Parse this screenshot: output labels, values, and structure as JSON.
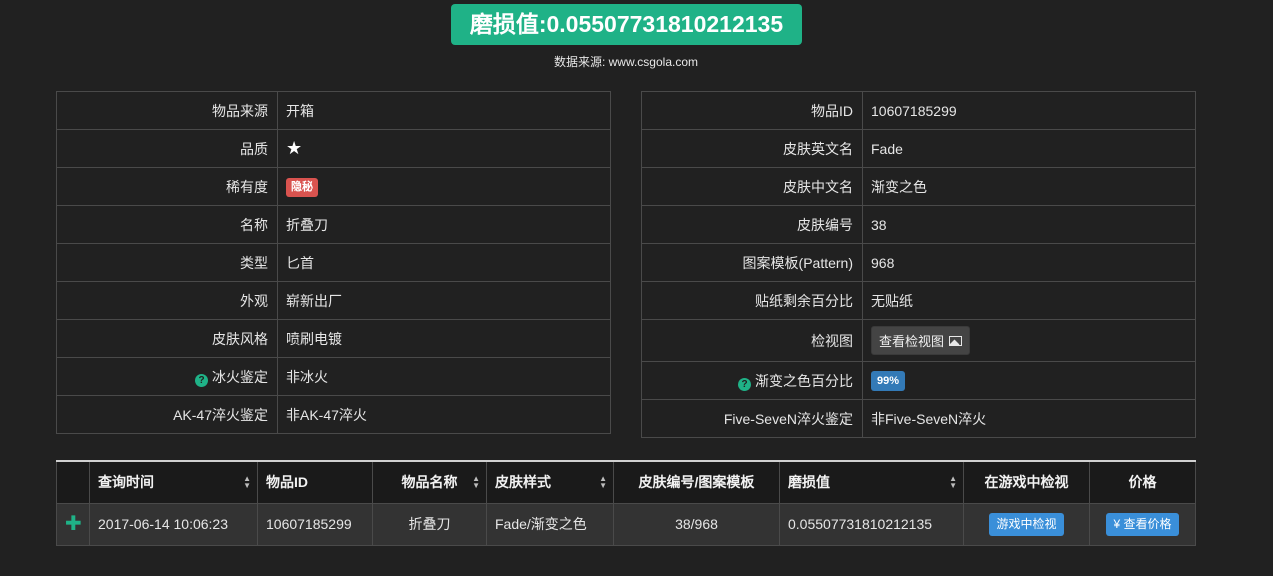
{
  "header": {
    "wear_title": "磨损值:0.05507731810212135",
    "source_prefix": "数据来源: ",
    "source_domain": "www.csgola.com"
  },
  "left_info": {
    "origin_label": "物品来源",
    "origin_value": "开箱",
    "quality_label": "品质",
    "quality_value": "★",
    "rarity_label": "稀有度",
    "rarity_value": "隐秘",
    "name_label": "名称",
    "name_value": "折叠刀",
    "type_label": "类型",
    "type_value": "匕首",
    "exterior_label": "外观",
    "exterior_value": "崭新出厂",
    "style_label": "皮肤风格",
    "style_value": "喷刷电镀",
    "fire_ice_label": "冰火鉴定",
    "fire_ice_value": "非冰火",
    "ak_label": "AK-47淬火鉴定",
    "ak_value": "非AK-47淬火"
  },
  "right_info": {
    "item_id_label": "物品ID",
    "item_id_value": "10607185299",
    "skin_en_label": "皮肤英文名",
    "skin_en_value": "Fade",
    "skin_cn_label": "皮肤中文名",
    "skin_cn_value": "渐变之色",
    "skin_no_label": "皮肤编号",
    "skin_no_value": "38",
    "pattern_label": "图案模板(Pattern)",
    "pattern_value": "968",
    "sticker_label": "贴纸剩余百分比",
    "sticker_value": "无贴纸",
    "inspect_img_label": "检视图",
    "inspect_img_button": "查看检视图",
    "fade_pct_label": "渐变之色百分比",
    "fade_pct_value": "99%",
    "fiveseven_label": "Five-SeveN淬火鉴定",
    "fiveseven_value": "非Five-SeveN淬火"
  },
  "results": {
    "headers": {
      "time": "查询时间",
      "item_id": "物品ID",
      "item_name": "物品名称",
      "skin_style": "皮肤样式",
      "skin_pattern": "皮肤编号/图案模板",
      "wear": "磨损值",
      "inspect": "在游戏中检视",
      "price": "价格"
    },
    "row": {
      "time": "2017-06-14 10:06:23",
      "item_id": "10607185299",
      "item_name": "折叠刀",
      "skin_style": "Fade/渐变之色",
      "skin_pattern": "38/968",
      "wear": "0.05507731810212135",
      "inspect_button": "游戏中检视",
      "price_button": "¥ 查看价格"
    }
  },
  "colors": {
    "accent_green": "#1fb287",
    "rarity_red": "#d9534f",
    "button_blue": "#3a8fd9",
    "background": "#212121"
  }
}
